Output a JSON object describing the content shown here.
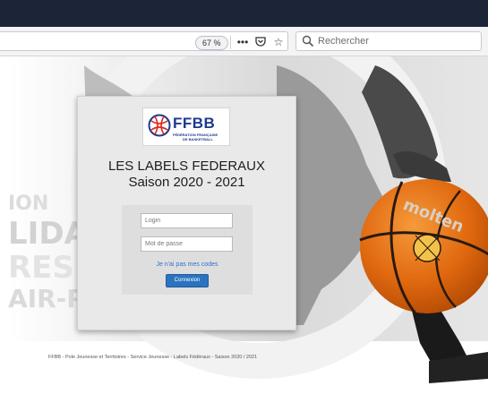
{
  "browser": {
    "zoom": "67 %",
    "search_placeholder": "Rechercher",
    "icons": [
      "more-icon",
      "pocket-icon",
      "star-icon",
      "search-icon"
    ]
  },
  "background": {
    "side_words": [
      "ION",
      "LIDAR",
      "RESP",
      "AIR-PLA"
    ],
    "ball_brand": "molten"
  },
  "login": {
    "logo_text": "FFBB",
    "logo_sub1": "FÉDÉRATION FRANÇAISE",
    "logo_sub2": "DE BASKETBALL",
    "title_line1": "LES LABELS FEDERAUX",
    "title_line2": "Saison 2020 - 2021",
    "login_placeholder": "Login",
    "password_placeholder": "Mot de passe",
    "forgot_link": "Je n'ai pas mes codes",
    "submit_label": "Connexion"
  },
  "footer": {
    "text": "FFBB - Pole Jeunesse et Territoires - Service Jeunesse - Labels Fédéraux - Saison 2020 / 2021"
  },
  "colors": {
    "titlebar": "#1c2538",
    "button": "#2b73bf",
    "link": "#2f6fd0",
    "logo_blue": "#1e3a8c",
    "ball_orange": "#e0680f"
  }
}
